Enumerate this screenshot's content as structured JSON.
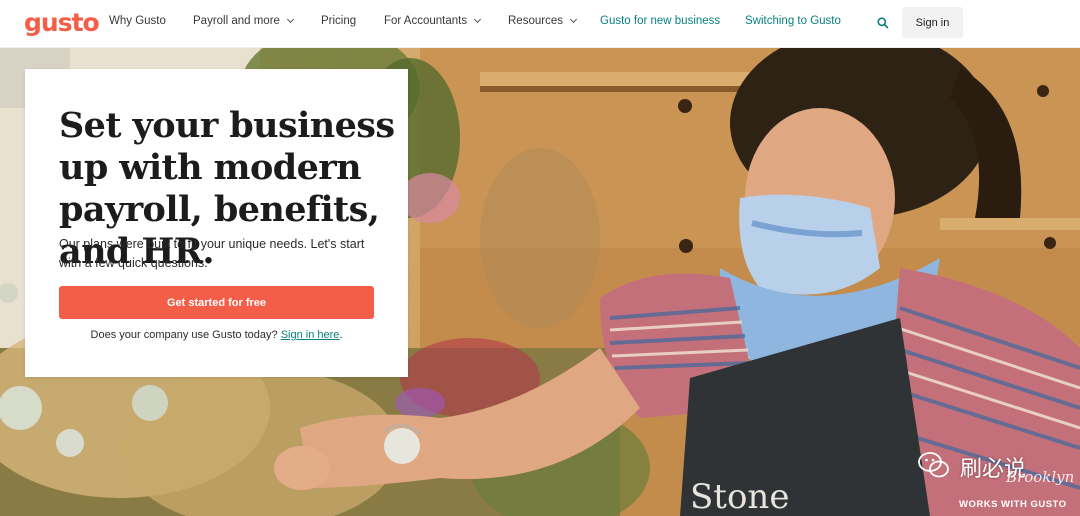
{
  "brand": {
    "logo_text": "gusto",
    "color": "#f45d48"
  },
  "nav": {
    "items": [
      {
        "label": "Why Gusto",
        "has_menu": false
      },
      {
        "label": "Payroll and more",
        "has_menu": true
      },
      {
        "label": "Pricing",
        "has_menu": false
      },
      {
        "label": "For Accountants",
        "has_menu": true
      },
      {
        "label": "Resources",
        "has_menu": true
      },
      {
        "label": "Gusto for new business",
        "has_menu": false
      },
      {
        "label": "Switching to Gusto",
        "has_menu": false
      }
    ],
    "search_icon": "search-icon",
    "signin_label": "Sign in",
    "accent_teal": "#0a8080"
  },
  "hero": {
    "headline": "Set your business up with modern payroll, benefits, and HR.",
    "subtext": "Our plans were built to fit your unique needs. Let's start with a few quick questions.",
    "cta_label": "Get started for free",
    "question_text": "Does your company use Gusto today? ",
    "question_link": "Sign in here",
    "question_end": "."
  },
  "photo": {
    "apron_text": "Stone",
    "caption": "WORKS WITH GUSTO",
    "signature": "Brooklyn"
  },
  "watermark": {
    "text": "刷必说"
  }
}
